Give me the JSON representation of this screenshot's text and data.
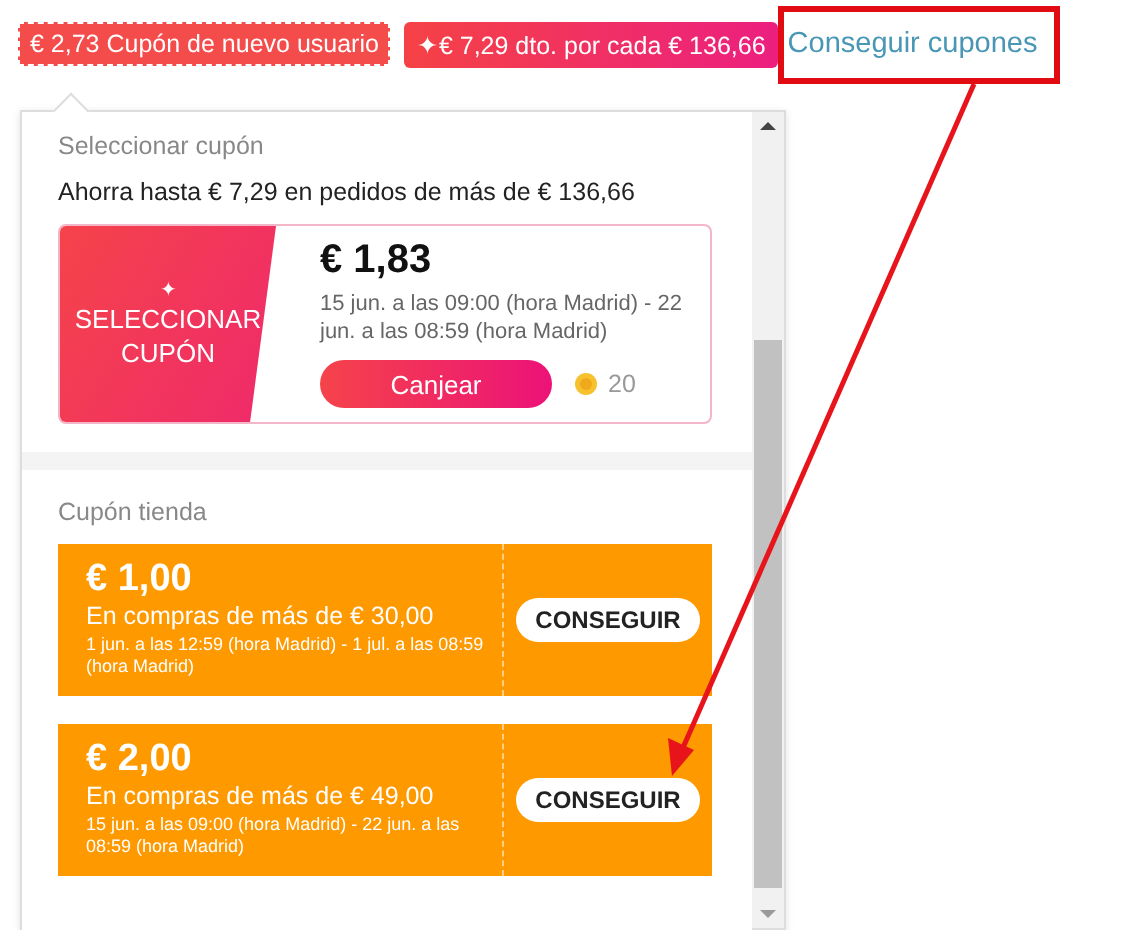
{
  "tags": [
    {
      "kind": "dashed",
      "text": "€ 2,73 Cupón de nuevo usuario"
    },
    {
      "kind": "gradient",
      "icon": "✦",
      "text": "€ 7,29 dto. por cada € 136,66"
    }
  ],
  "link": "Conseguir cupones",
  "select_section": {
    "title": "Seleccionar cupón",
    "subtitle": "Ahorra hasta € 7,29 en pedidos de más de € 136,66",
    "coupon": {
      "icon": "✦",
      "label_lines": [
        "SELECCIONAR",
        "CUPÓN"
      ],
      "amount": "€ 1,83",
      "dates": "15 jun. a las 09:00 (hora Madrid) - 22 jun. a las 08:59 (hora Madrid)",
      "button": "Canjear",
      "coins": "20"
    }
  },
  "store_section": {
    "title": "Cupón tienda",
    "coupons": [
      {
        "amount": "€ 1,00",
        "condition": "En compras de más de € 30,00",
        "dates": "1 jun. a las 12:59 (hora Madrid) - 1 jul. a las 08:59 (hora Madrid)",
        "button": "CONSEGUIR"
      },
      {
        "amount": "€ 2,00",
        "condition": "En compras de más de € 49,00",
        "dates": "15 jun. a las 09:00 (hora Madrid) - 22 jun. a las 08:59 (hora Madrid)",
        "button": "CONSEGUIR"
      }
    ]
  }
}
